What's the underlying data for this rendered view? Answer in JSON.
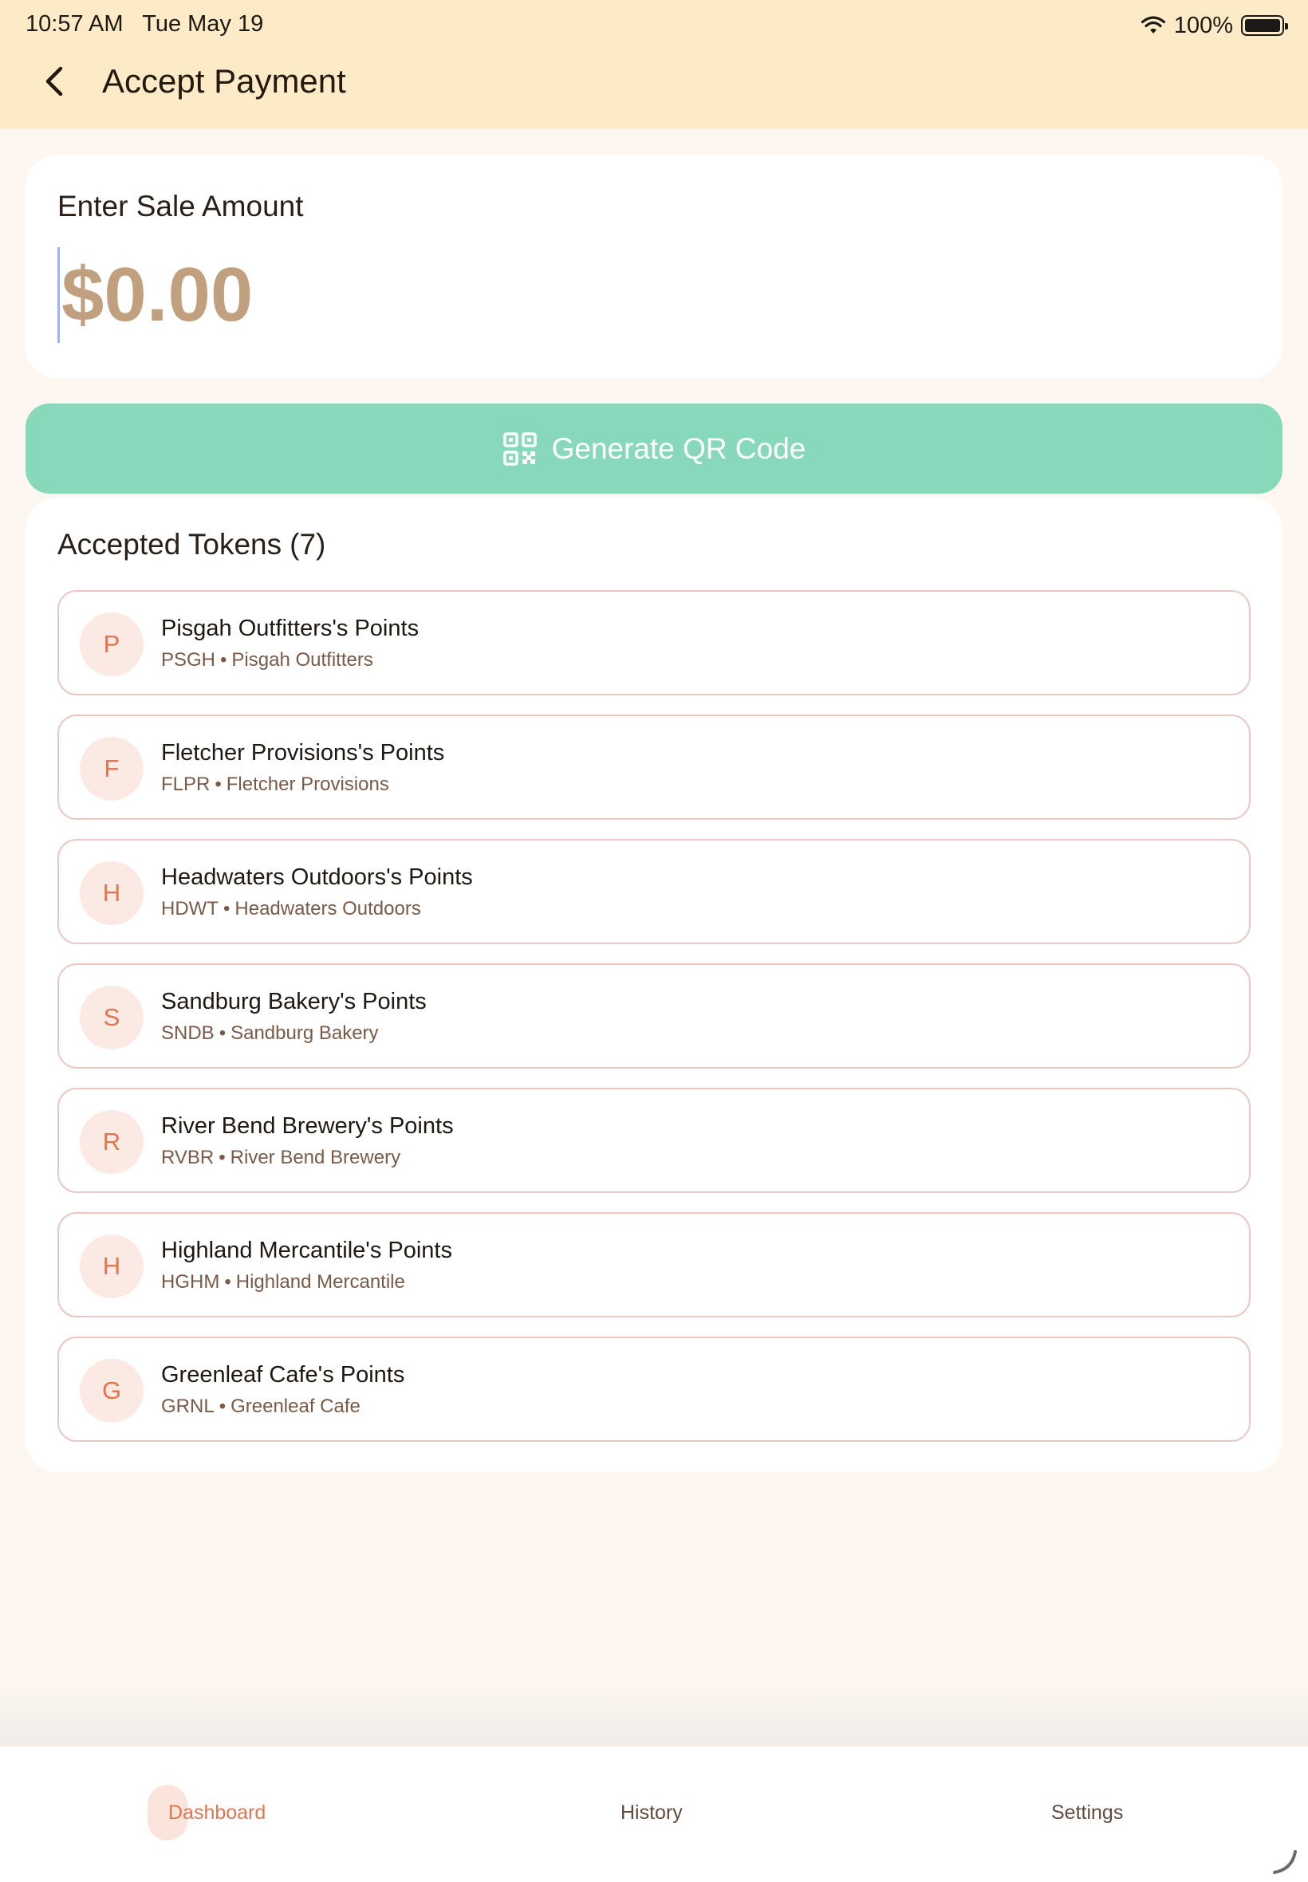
{
  "status_bar": {
    "time": "10:57 AM",
    "date": "Tue May 19",
    "battery": "100%"
  },
  "header": {
    "title": "Accept Payment"
  },
  "amount": {
    "label": "Enter Sale Amount",
    "placeholder": "$0.00"
  },
  "generate_button": {
    "label": "Generate QR Code"
  },
  "tokens": {
    "title": "Accepted Tokens",
    "count": "(7)",
    "items": [
      {
        "initial": "P",
        "name": "Pisgah Outfitters's Points",
        "symbol": "PSGH",
        "merchant": "Pisgah Outfitters"
      },
      {
        "initial": "F",
        "name": "Fletcher Provisions's Points",
        "symbol": "FLPR",
        "merchant": "Fletcher Provisions"
      },
      {
        "initial": "H",
        "name": "Headwaters Outdoors's Points",
        "symbol": "HDWT",
        "merchant": "Headwaters Outdoors"
      },
      {
        "initial": "S",
        "name": "Sandburg Bakery's Points",
        "symbol": "SNDB",
        "merchant": "Sandburg Bakery"
      },
      {
        "initial": "R",
        "name": "River Bend Brewery's Points",
        "symbol": "RVBR",
        "merchant": "River Bend Brewery"
      },
      {
        "initial": "H",
        "name": "Highland Mercantile's Points",
        "symbol": "HGHM",
        "merchant": "Highland Mercantile"
      },
      {
        "initial": "G",
        "name": "Greenleaf Cafe's Points",
        "symbol": "GRNL",
        "merchant": "Greenleaf Cafe"
      }
    ]
  },
  "tabs": {
    "dashboard": "Dashboard",
    "history": "History",
    "settings": "Settings"
  },
  "colors": {
    "header_bg": "#fdebc7",
    "accent_green": "#88d9bb",
    "accent_orange": "#e07650",
    "amount_text": "#c0a07e"
  }
}
